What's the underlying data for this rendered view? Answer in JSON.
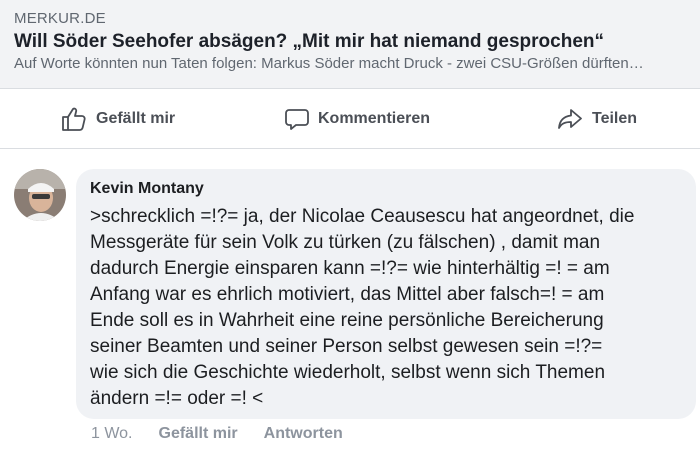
{
  "link_preview": {
    "source": "MERKUR.DE",
    "title": "Will Söder Seehofer absägen? „Mit mir hat niemand gesprochen“",
    "description": "Auf Worte könnten nun Taten folgen: Markus Söder macht Druck - zwei CSU-Größen dürften…"
  },
  "actions": {
    "like_label": "Gefällt mir",
    "comment_label": "Kommentieren",
    "share_label": "Teilen"
  },
  "comment": {
    "author": "Kevin Montany",
    "text": ">schrecklich =!?= ja, der Nicolae Ceausescu hat angeordnet, die\nMessgeräte für sein Volk zu türken (zu fälschen) , damit man\ndadurch Energie einsparen kann =!?= wie hinterhältig =! = am\nAnfang war es ehrlich motiviert, das Mittel aber falsch=! = am\nEnde soll es in Wahrheit eine reine persönliche Bereicherung\nseiner Beamten und seiner Person selbst  gewesen sein =!?=\nwie sich die Geschichte wiederholt, selbst wenn sich Themen\nändern =!= oder =! <",
    "time": "1 Wo.",
    "like_label": "Gefällt mir",
    "reply_label": "Antworten"
  },
  "icons": {
    "like": "thumbs-up-icon",
    "comment": "speech-bubble-icon",
    "share": "share-arrow-icon"
  },
  "colors": {
    "secondary_text": "#606770",
    "action_text": "#4b4f56",
    "bubble_bg": "#f0f2f5",
    "card_bg": "#f2f3f5"
  }
}
